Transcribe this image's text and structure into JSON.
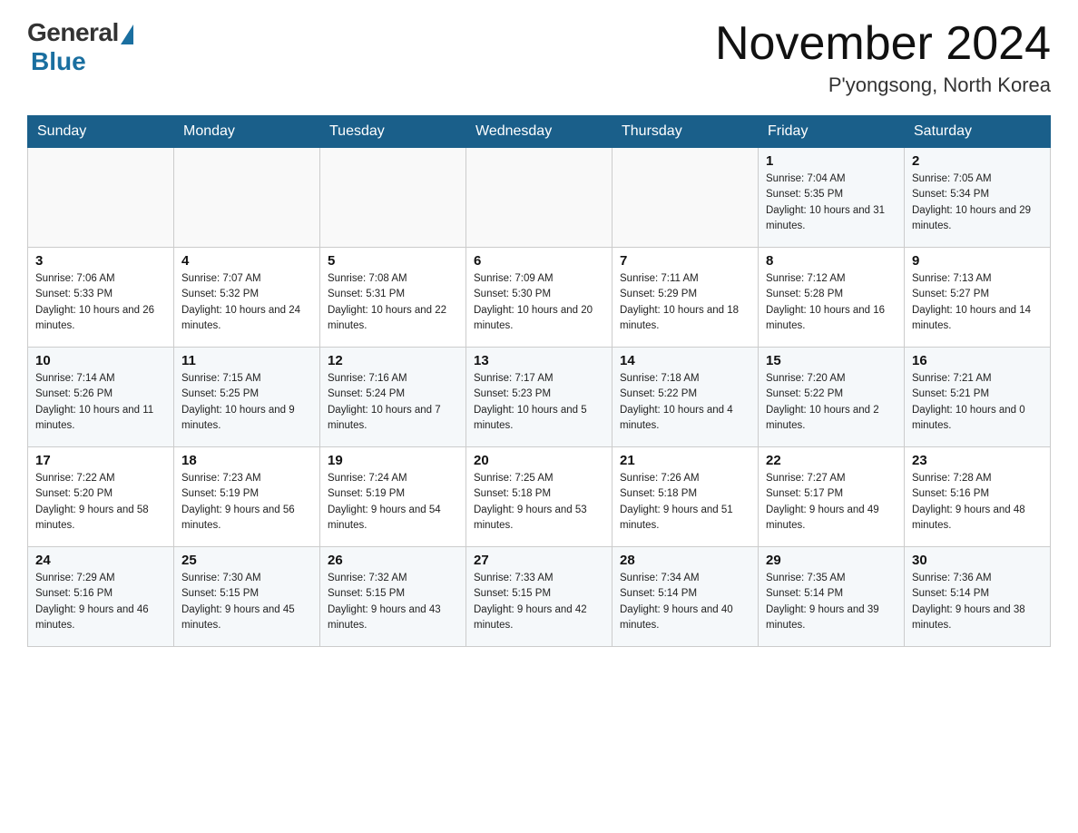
{
  "header": {
    "logo_general": "General",
    "logo_blue": "Blue",
    "month_title": "November 2024",
    "location": "P'yongsong, North Korea"
  },
  "weekdays": [
    "Sunday",
    "Monday",
    "Tuesday",
    "Wednesday",
    "Thursday",
    "Friday",
    "Saturday"
  ],
  "weeks": [
    [
      {
        "day": "",
        "info": ""
      },
      {
        "day": "",
        "info": ""
      },
      {
        "day": "",
        "info": ""
      },
      {
        "day": "",
        "info": ""
      },
      {
        "day": "",
        "info": ""
      },
      {
        "day": "1",
        "info": "Sunrise: 7:04 AM\nSunset: 5:35 PM\nDaylight: 10 hours and 31 minutes."
      },
      {
        "day": "2",
        "info": "Sunrise: 7:05 AM\nSunset: 5:34 PM\nDaylight: 10 hours and 29 minutes."
      }
    ],
    [
      {
        "day": "3",
        "info": "Sunrise: 7:06 AM\nSunset: 5:33 PM\nDaylight: 10 hours and 26 minutes."
      },
      {
        "day": "4",
        "info": "Sunrise: 7:07 AM\nSunset: 5:32 PM\nDaylight: 10 hours and 24 minutes."
      },
      {
        "day": "5",
        "info": "Sunrise: 7:08 AM\nSunset: 5:31 PM\nDaylight: 10 hours and 22 minutes."
      },
      {
        "day": "6",
        "info": "Sunrise: 7:09 AM\nSunset: 5:30 PM\nDaylight: 10 hours and 20 minutes."
      },
      {
        "day": "7",
        "info": "Sunrise: 7:11 AM\nSunset: 5:29 PM\nDaylight: 10 hours and 18 minutes."
      },
      {
        "day": "8",
        "info": "Sunrise: 7:12 AM\nSunset: 5:28 PM\nDaylight: 10 hours and 16 minutes."
      },
      {
        "day": "9",
        "info": "Sunrise: 7:13 AM\nSunset: 5:27 PM\nDaylight: 10 hours and 14 minutes."
      }
    ],
    [
      {
        "day": "10",
        "info": "Sunrise: 7:14 AM\nSunset: 5:26 PM\nDaylight: 10 hours and 11 minutes."
      },
      {
        "day": "11",
        "info": "Sunrise: 7:15 AM\nSunset: 5:25 PM\nDaylight: 10 hours and 9 minutes."
      },
      {
        "day": "12",
        "info": "Sunrise: 7:16 AM\nSunset: 5:24 PM\nDaylight: 10 hours and 7 minutes."
      },
      {
        "day": "13",
        "info": "Sunrise: 7:17 AM\nSunset: 5:23 PM\nDaylight: 10 hours and 5 minutes."
      },
      {
        "day": "14",
        "info": "Sunrise: 7:18 AM\nSunset: 5:22 PM\nDaylight: 10 hours and 4 minutes."
      },
      {
        "day": "15",
        "info": "Sunrise: 7:20 AM\nSunset: 5:22 PM\nDaylight: 10 hours and 2 minutes."
      },
      {
        "day": "16",
        "info": "Sunrise: 7:21 AM\nSunset: 5:21 PM\nDaylight: 10 hours and 0 minutes."
      }
    ],
    [
      {
        "day": "17",
        "info": "Sunrise: 7:22 AM\nSunset: 5:20 PM\nDaylight: 9 hours and 58 minutes."
      },
      {
        "day": "18",
        "info": "Sunrise: 7:23 AM\nSunset: 5:19 PM\nDaylight: 9 hours and 56 minutes."
      },
      {
        "day": "19",
        "info": "Sunrise: 7:24 AM\nSunset: 5:19 PM\nDaylight: 9 hours and 54 minutes."
      },
      {
        "day": "20",
        "info": "Sunrise: 7:25 AM\nSunset: 5:18 PM\nDaylight: 9 hours and 53 minutes."
      },
      {
        "day": "21",
        "info": "Sunrise: 7:26 AM\nSunset: 5:18 PM\nDaylight: 9 hours and 51 minutes."
      },
      {
        "day": "22",
        "info": "Sunrise: 7:27 AM\nSunset: 5:17 PM\nDaylight: 9 hours and 49 minutes."
      },
      {
        "day": "23",
        "info": "Sunrise: 7:28 AM\nSunset: 5:16 PM\nDaylight: 9 hours and 48 minutes."
      }
    ],
    [
      {
        "day": "24",
        "info": "Sunrise: 7:29 AM\nSunset: 5:16 PM\nDaylight: 9 hours and 46 minutes."
      },
      {
        "day": "25",
        "info": "Sunrise: 7:30 AM\nSunset: 5:15 PM\nDaylight: 9 hours and 45 minutes."
      },
      {
        "day": "26",
        "info": "Sunrise: 7:32 AM\nSunset: 5:15 PM\nDaylight: 9 hours and 43 minutes."
      },
      {
        "day": "27",
        "info": "Sunrise: 7:33 AM\nSunset: 5:15 PM\nDaylight: 9 hours and 42 minutes."
      },
      {
        "day": "28",
        "info": "Sunrise: 7:34 AM\nSunset: 5:14 PM\nDaylight: 9 hours and 40 minutes."
      },
      {
        "day": "29",
        "info": "Sunrise: 7:35 AM\nSunset: 5:14 PM\nDaylight: 9 hours and 39 minutes."
      },
      {
        "day": "30",
        "info": "Sunrise: 7:36 AM\nSunset: 5:14 PM\nDaylight: 9 hours and 38 minutes."
      }
    ]
  ]
}
